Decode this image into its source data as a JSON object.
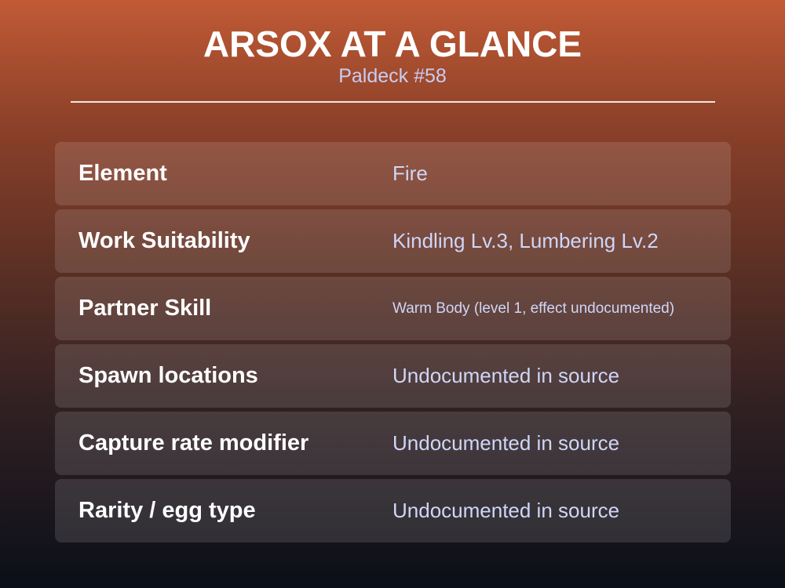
{
  "header": {
    "title": "ARSOX AT A GLANCE",
    "subtitle": "Paldeck #58"
  },
  "rows": [
    {
      "label": "Element",
      "value": "Fire"
    },
    {
      "label": "Work Suitability",
      "value": "Kindling Lv.3, Lumbering Lv.2"
    },
    {
      "label": "Partner Skill",
      "value": "Warm Body (level 1, effect undocumented)"
    },
    {
      "label": "Spawn locations",
      "value": "Undocumented in source"
    },
    {
      "label": "Capture rate modifier",
      "value": "Undocumented in source"
    },
    {
      "label": "Rarity / egg type",
      "value": "Undocumented in source"
    }
  ]
}
